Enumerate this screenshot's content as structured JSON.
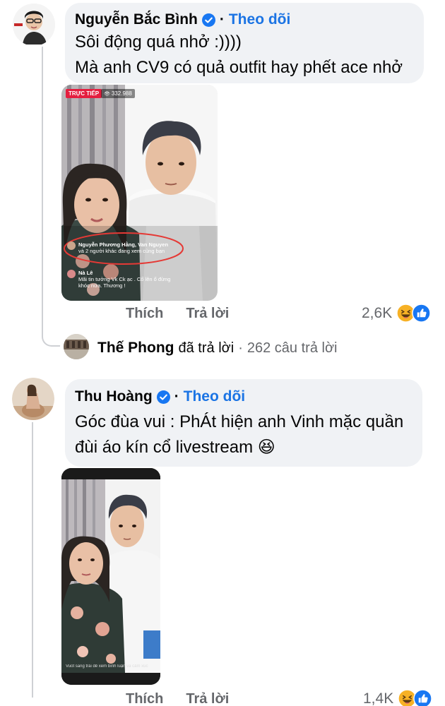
{
  "comments": [
    {
      "author": "Nguyễn Bắc Bình",
      "verified": true,
      "follow_label": "Theo dõi",
      "text_lines": [
        "Sôi động quá nhở :))))",
        "Mà anh CV9 có quả outfit hay phết ace nhở"
      ],
      "live_badge": "TRỰC TIẾP",
      "viewer_count": "332.988",
      "overlay_comments": [
        {
          "name": "Nguyễn Phương Hằng, Van Nguyen",
          "text": "và 2 người khác đang xem cùng bạn"
        },
        {
          "name": "Nà Lê",
          "text": "Mãi tin tưởng Vk Ck ạc . Cố lên ổ đừng khóc nữa. Thương !"
        }
      ],
      "like_label": "Thích",
      "reply_label": "Trả lời",
      "reaction_count": "2,6K"
    },
    {
      "author": "Thu Hoàng",
      "verified": true,
      "follow_label": "Theo dõi",
      "text_lines": [
        "Góc đùa vui : PhÁt hiện anh Vinh mặc quần",
        "đùi áo kín cổ livestream 😆"
      ],
      "overlay_footer": "Vuốt sang trái để xem bình luận và cảm xúc",
      "like_label": "Thích",
      "reply_label": "Trả lời",
      "reaction_count": "1,4K"
    }
  ],
  "reply_summary": {
    "author": "Thế Phong",
    "action": "đã trả lời",
    "separator": "·",
    "count": "262 câu trả lời"
  },
  "colors": {
    "link_blue": "#1b74e4",
    "bubble": "#f0f2f5",
    "secondary_text": "#65676b",
    "live_red": "#e41e3f",
    "like_blue": "#1877f2",
    "haha_yellow": "#f7b125"
  },
  "icons": [
    "verified-badge-icon",
    "haha-reaction-icon",
    "like-reaction-icon",
    "eye-icon"
  ]
}
